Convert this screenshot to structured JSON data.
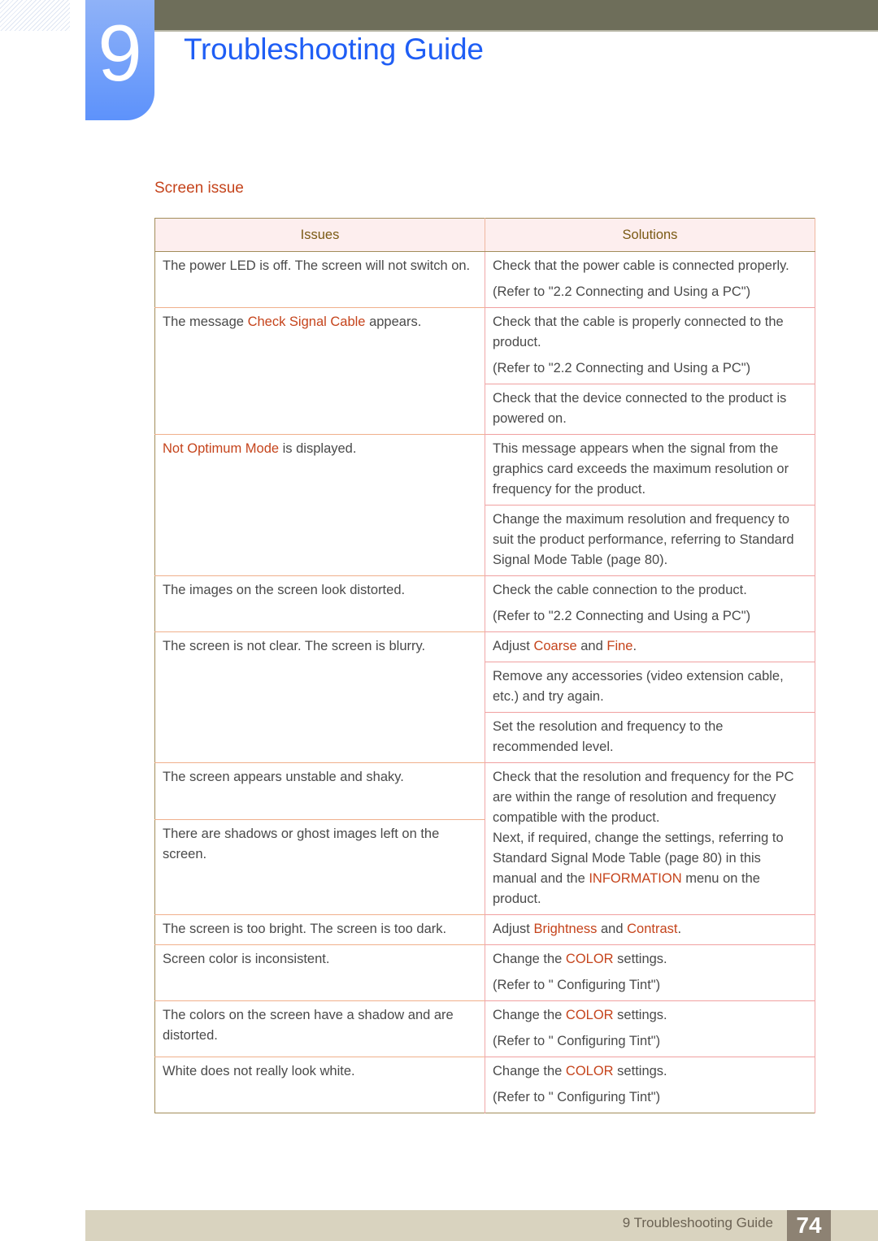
{
  "header": {
    "chapter_number": "9",
    "title": "Troubleshooting Guide"
  },
  "section": {
    "title": "Screen issue"
  },
  "table": {
    "headers": [
      "Issues",
      "Solutions"
    ],
    "rows": [
      {
        "issue": [
          "The power LED is off. The screen will not switch on."
        ],
        "solutions": [
          {
            "text": "Check that the power cable is connected properly.",
            "ref": "(Refer to \"2.2 Connecting and Using a PC\")"
          }
        ]
      },
      {
        "issue": [
          "The message ",
          "Check Signal Cable",
          " appears."
        ],
        "solutions": [
          {
            "text": "Check that the cable is properly connected to the product.",
            "ref": "(Refer to \"2.2 Connecting and Using a PC\")"
          },
          {
            "text": "Check that the device connected to the product is powered on."
          }
        ]
      },
      {
        "issue": [
          "",
          "Not Optimum Mode",
          " is displayed."
        ],
        "solutions": [
          {
            "text": "This message appears when the signal from the graphics card exceeds the maximum resolution or frequency for the product."
          },
          {
            "text": "Change the maximum resolution and frequency to suit the product performance, referring to Standard Signal Mode Table (page 80)."
          }
        ]
      },
      {
        "issue": [
          "The images on the screen look distorted."
        ],
        "solutions": [
          {
            "text": "Check the cable connection to the product.",
            "ref": "(Refer to \"2.2 Connecting and Using a PC\")"
          }
        ]
      },
      {
        "issue": [
          "The screen is not clear. The screen is blurry."
        ],
        "solutions": [
          {
            "parts": [
              "Adjust ",
              "Coarse",
              " and ",
              "Fine",
              "."
            ]
          },
          {
            "text": "Remove any accessories (video extension cable, etc.) and try again."
          },
          {
            "text": "Set the resolution and frequency to the recommended level."
          }
        ]
      },
      {
        "issues_multi": [
          "The screen appears unstable and shaky.",
          "There are shadows or ghost images left on the screen."
        ],
        "solution_parts": [
          "Check that the resolution and frequency for the PC are within the range of resolution and frequency compatible with the product.",
          "Next, if required, change the settings, referring to Standard Signal Mode Table (page 80) in this manual and the ",
          "INFORMATION",
          " menu on the product."
        ]
      },
      {
        "issue": [
          "The screen is too bright. The screen is too dark."
        ],
        "solutions": [
          {
            "parts": [
              "Adjust ",
              "Brightness",
              " and ",
              "Contrast",
              "."
            ]
          }
        ]
      },
      {
        "issue": [
          "Screen color is inconsistent."
        ],
        "solutions": [
          {
            "parts": [
              "Change the ",
              "COLOR",
              " settings."
            ],
            "ref": "(Refer to \" Configuring Tint\")"
          }
        ]
      },
      {
        "issue": [
          "The colors on the screen have a shadow and are distorted."
        ],
        "solutions": [
          {
            "parts": [
              "Change the ",
              "COLOR",
              " settings."
            ],
            "ref": "(Refer to \" Configuring Tint\")"
          }
        ]
      },
      {
        "issue": [
          "White does not really look white."
        ],
        "solutions": [
          {
            "parts": [
              "Change the ",
              "COLOR",
              " settings."
            ],
            "ref": "(Refer to \" Configuring Tint\")"
          }
        ]
      }
    ]
  },
  "footer": {
    "chapter_label": "9 Troubleshooting Guide",
    "page_number": "74"
  },
  "colors": {
    "title_blue": "#1f5ef5",
    "highlight_orange": "#c5441c",
    "header_band": "#6e6e5a",
    "chapter_tab": "#5d92fb",
    "table_header_bg": "#fdeeee",
    "footer_bar": "#d9d3bf",
    "page_number_bg": "#8d8273"
  }
}
